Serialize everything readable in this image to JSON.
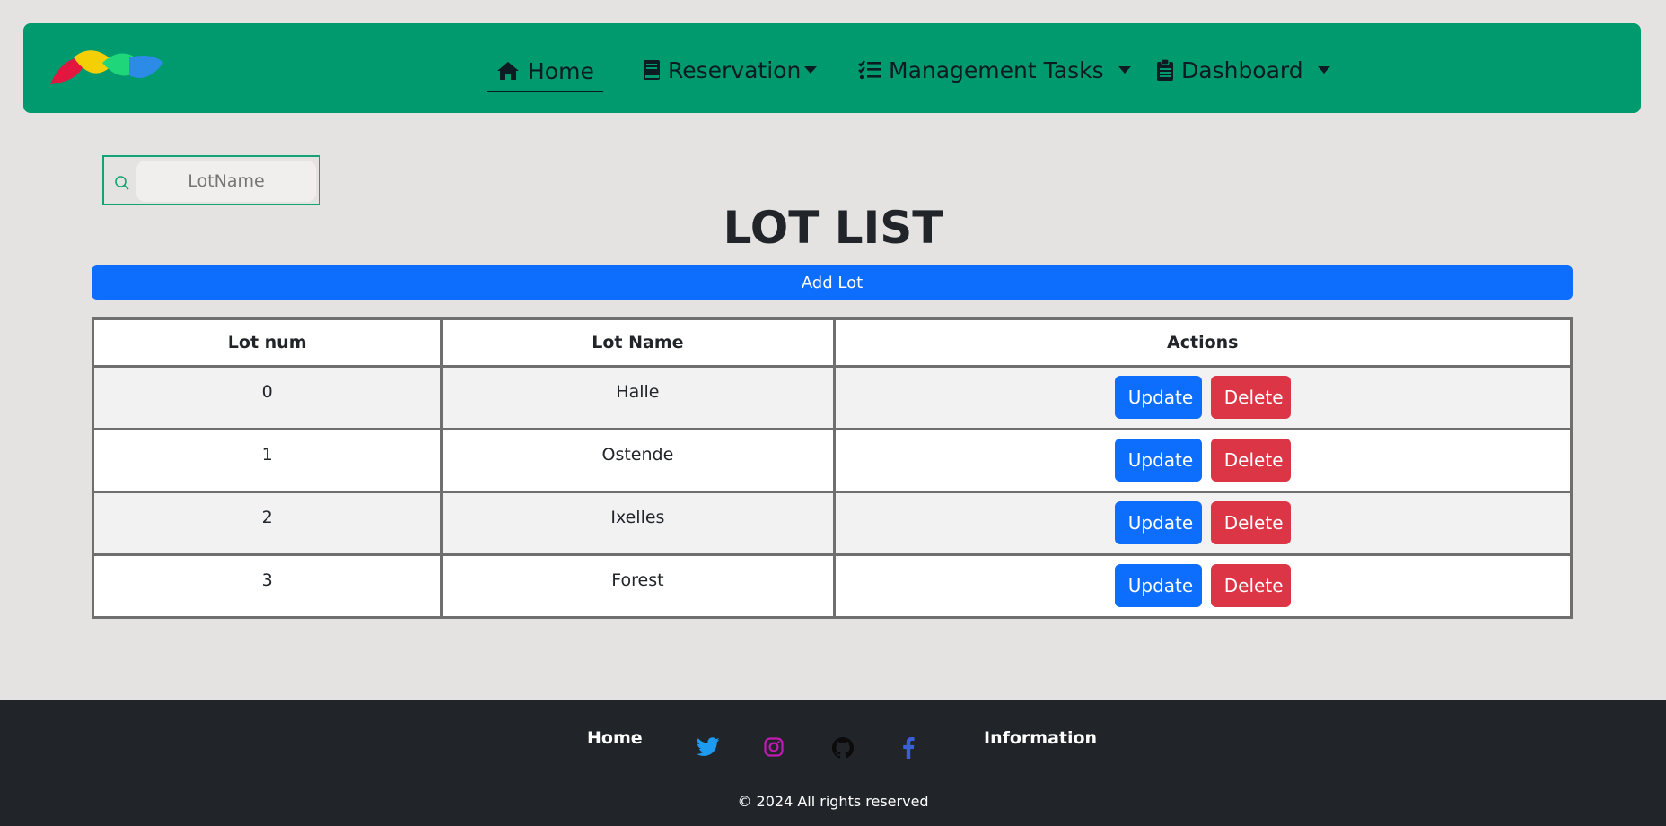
{
  "nav": {
    "items": [
      {
        "label": "Home",
        "icon": "home-icon",
        "active": true
      },
      {
        "label": "Reservation",
        "icon": "book-icon",
        "dropdown": true
      },
      {
        "label": "Management Tasks",
        "icon": "list-check-icon",
        "dropdown": true
      },
      {
        "label": "Dashboard",
        "icon": "clipboard-icon",
        "dropdown": true
      }
    ]
  },
  "search": {
    "placeholder": "LotName",
    "value": ""
  },
  "page": {
    "title": "LOT LIST",
    "add_label": "Add Lot"
  },
  "table": {
    "headers": [
      "Lot num",
      "Lot Name",
      "Actions"
    ],
    "rows": [
      {
        "num": "0",
        "name": "Halle"
      },
      {
        "num": "1",
        "name": "Ostende"
      },
      {
        "num": "2",
        "name": "Ixelles"
      },
      {
        "num": "3",
        "name": "Forest"
      }
    ],
    "update_label": "Update",
    "delete_label": "Delete"
  },
  "footer": {
    "home_label": "Home",
    "info_label": "Information",
    "social": [
      "twitter-icon",
      "instagram-icon",
      "github-icon",
      "facebook-icon"
    ],
    "copyright": "© 2024 All rights reserved"
  },
  "colors": {
    "navbar": "#009a6f",
    "primary": "#0d6efd",
    "danger": "#dc3545",
    "footer": "#212529",
    "background": "#e4e3e1"
  }
}
